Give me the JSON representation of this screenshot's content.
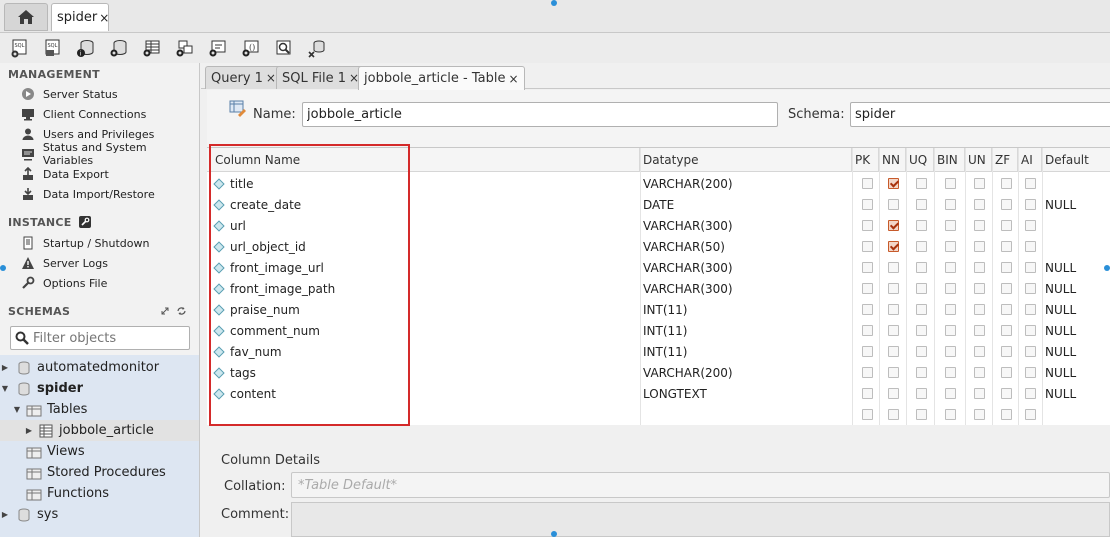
{
  "top_tabs": {
    "connection_label": "spider",
    "close_glyph": "×"
  },
  "toolbar": {
    "icons": [
      "new-sql-tab-icon",
      "open-sql-script-icon",
      "schema-inspector-icon",
      "create-schema-icon",
      "create-table-icon",
      "create-view-icon",
      "create-procedure-icon",
      "create-function-icon",
      "search-table-data-icon",
      "reconnect-icon"
    ]
  },
  "sidebar": {
    "management_header": "MANAGEMENT",
    "management_items": [
      "Server Status",
      "Client Connections",
      "Users and Privileges",
      "Status and System Variables",
      "Data Export",
      "Data Import/Restore"
    ],
    "instance_header": "INSTANCE",
    "instance_items": [
      "Startup / Shutdown",
      "Server Logs",
      "Options File"
    ],
    "schemas_header": "SCHEMAS",
    "filter_placeholder": "Filter objects",
    "tree": {
      "schema1": "automatedmonitor",
      "schema2": "spider",
      "tables": "Tables",
      "table1": "jobbole_article",
      "views": "Views",
      "procs": "Stored Procedures",
      "funcs": "Functions",
      "schema3": "sys"
    }
  },
  "editor_tabs": [
    {
      "label": "Query 1"
    },
    {
      "label": "SQL File 1"
    },
    {
      "label": "jobbole_article - Table"
    }
  ],
  "table_editor": {
    "name_label": "Name:",
    "name_value": "jobbole_article",
    "schema_label": "Schema:",
    "schema_value": "spider"
  },
  "grid": {
    "headers": {
      "name": "Column Name",
      "type": "Datatype",
      "pk": "PK",
      "nn": "NN",
      "uq": "UQ",
      "bin": "BIN",
      "un": "UN",
      "zf": "ZF",
      "ai": "AI",
      "def": "Default"
    },
    "rows": [
      {
        "name": "title",
        "type": "VARCHAR(200)",
        "nn": true,
        "default": ""
      },
      {
        "name": "create_date",
        "type": "DATE",
        "nn": false,
        "default": "NULL"
      },
      {
        "name": "url",
        "type": "VARCHAR(300)",
        "nn": true,
        "default": ""
      },
      {
        "name": "url_object_id",
        "type": "VARCHAR(50)",
        "nn": true,
        "default": ""
      },
      {
        "name": "front_image_url",
        "type": "VARCHAR(300)",
        "nn": false,
        "default": "NULL"
      },
      {
        "name": "front_image_path",
        "type": "VARCHAR(300)",
        "nn": false,
        "default": "NULL"
      },
      {
        "name": "praise_num",
        "type": "INT(11)",
        "nn": false,
        "default": "NULL"
      },
      {
        "name": "comment_num",
        "type": "INT(11)",
        "nn": false,
        "default": "NULL"
      },
      {
        "name": "fav_num",
        "type": "INT(11)",
        "nn": false,
        "default": "NULL"
      },
      {
        "name": "tags",
        "type": "VARCHAR(200)",
        "nn": false,
        "default": "NULL"
      },
      {
        "name": "content",
        "type": "LONGTEXT",
        "nn": false,
        "default": "NULL"
      }
    ]
  },
  "details": {
    "title": "Column Details",
    "collation_label": "Collation:",
    "collation_value": "*Table Default*",
    "comment_label": "Comment:"
  },
  "colors": {
    "highlight": "#d42a2a",
    "checked": "#c75a2a",
    "tree_bg": "#dde6f2"
  }
}
